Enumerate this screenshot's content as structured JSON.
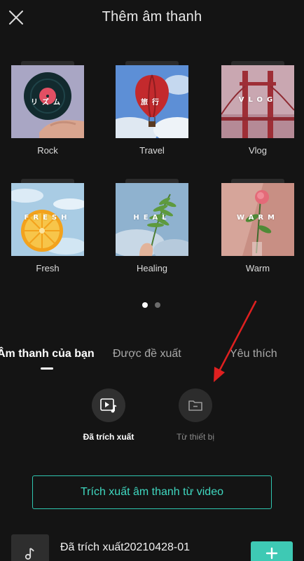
{
  "header": {
    "title": "Thêm âm thanh"
  },
  "genres": [
    {
      "label": "Rock",
      "cover_text": "リズム"
    },
    {
      "label": "Travel",
      "cover_text": "旅行"
    },
    {
      "label": "Vlog",
      "cover_text": "VLOG"
    },
    {
      "label": "Fresh",
      "cover_text": "FRESH"
    },
    {
      "label": "Healing",
      "cover_text": "HEAL"
    },
    {
      "label": "Warm",
      "cover_text": "WARM"
    }
  ],
  "pager": {
    "total": 2,
    "active": 1
  },
  "tabs": [
    {
      "label": "Âm thanh của bạn",
      "active": true
    },
    {
      "label": "Được đề xuất",
      "active": false
    },
    {
      "label": "Yêu thích",
      "active": false
    }
  ],
  "sources": [
    {
      "label": "Đã trích xuất",
      "icon": "video-music-icon",
      "active": true
    },
    {
      "label": "Từ thiết bị",
      "icon": "folder-icon",
      "active": false
    }
  ],
  "extract_button": {
    "label": "Trích xuất âm thanh từ video"
  },
  "track": {
    "title": "Đã trích xuất20210428-01",
    "icon": "music-note-icon"
  },
  "add_button": {
    "label": "+"
  },
  "colors": {
    "background": "#141414",
    "accent": "#3ec9b4",
    "annotation_arrow": "#e02020"
  }
}
